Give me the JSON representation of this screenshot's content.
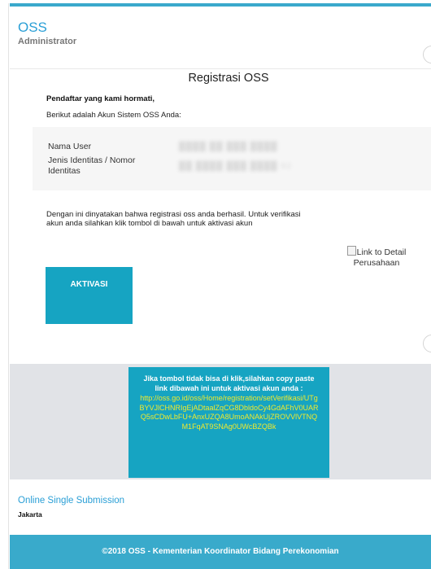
{
  "header": {
    "brand": "OSS",
    "subtitle": "Administrator"
  },
  "email": {
    "title": "Registrasi OSS",
    "greeting": "Pendaftar yang kami hormati,",
    "intro": "Berikut adalah Akun Sistem OSS Anda:",
    "fields": [
      {
        "label": "Nama User",
        "value": "████ ██ ███ ████"
      },
      {
        "label": "Jenis Identitas / Nomor Identitas",
        "value": "██ ████ ███ ████ 92"
      }
    ],
    "message": "Dengan ini dinyatakan bahwa registrasi oss anda berhasil. Untuk verifikasi akun anda silahkan klik tombol di bawah untuk aktivasi akun",
    "activation_button": "AKTIVASI",
    "detail_link_alt": "Link to Detail Perusahaan",
    "copy_instruction": "Jika tombol tidak bisa di klik,silahkan copy paste link dibawah ini untuk aktivasi akun anda :",
    "activation_url": "http://oss.go.id/oss/Home/registration/setVerifikasi/UTgBYVJlCHNRIgEjADtaalZqCG8DbldoCy4GdAFhV0UARQ5sCDwLbFU+AnxUZQA8UmoANAkUjZROVVlVTNQM1FqAT9SNAg0UWcBZQBk"
  },
  "footer": {
    "site_name": "Online Single Submission",
    "city": "Jakarta",
    "copyright": "©2018 OSS - Kementerian Koordinator Bidang Perekonomian"
  },
  "colors": {
    "accent": "#16a4c2",
    "brand_blue": "#2a9fd6",
    "link_yellow": "#f0ea2d",
    "band_gray": "#e1e3e7"
  }
}
